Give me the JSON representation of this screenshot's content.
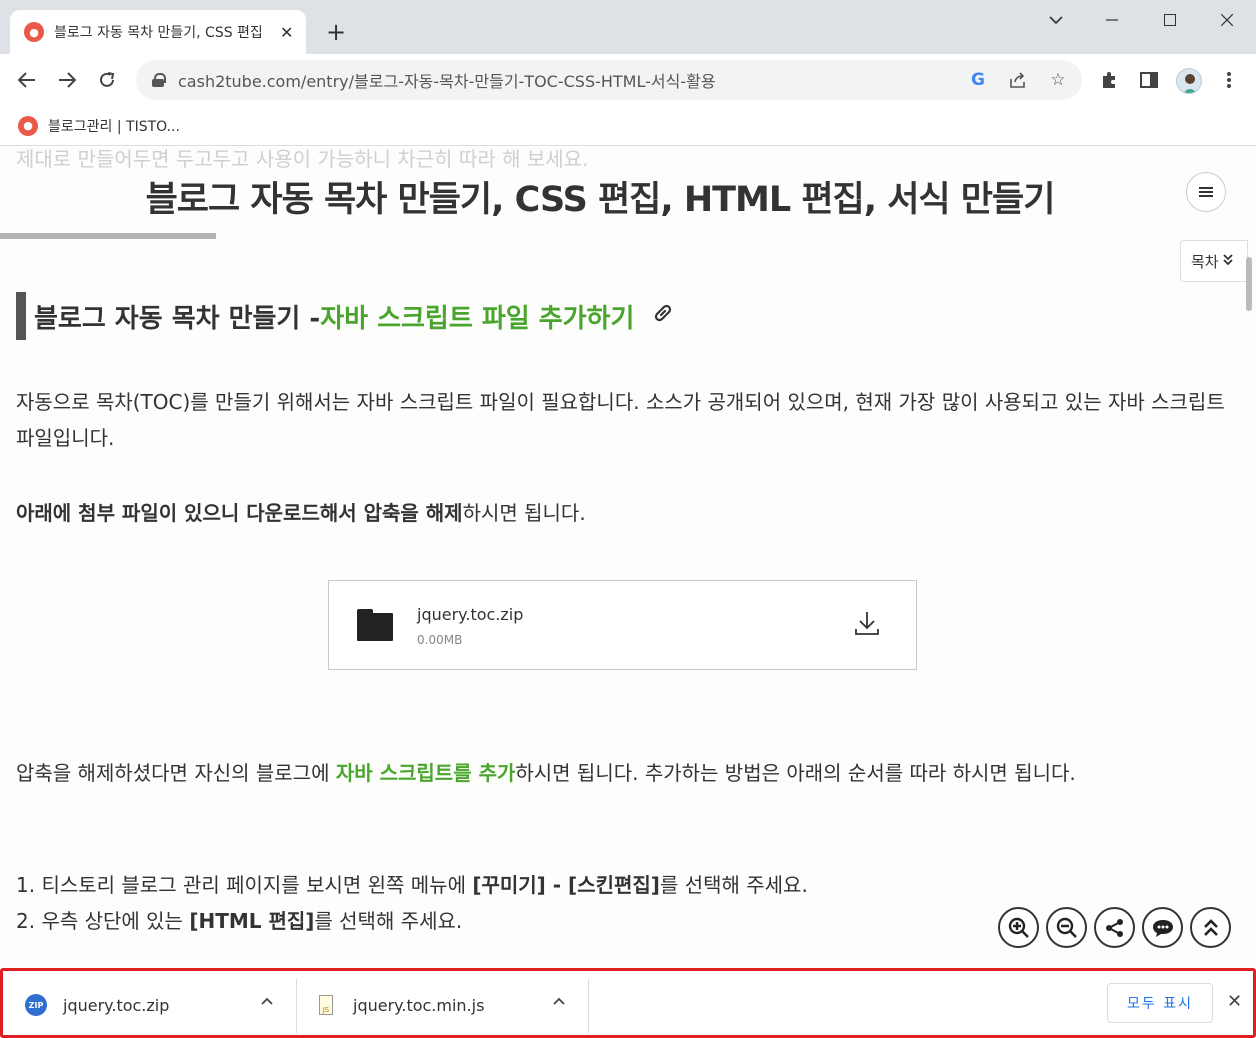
{
  "browser": {
    "tab_title": "블로그 자동 목차 만들기, CSS 편집",
    "tab_favicon": "tistory-favicon",
    "tab_close": "✕",
    "new_tab": "+",
    "url": "cash2tube.com/entry/블로그-자동-목차-만들기-TOC-CSS-HTML-서식-활용",
    "bookmark_label": "블로그관리 | TISTO..."
  },
  "page": {
    "ghost_text": "제대로 만들어두면 두고두고 사용이 가능하니 차근히 따라 해 보세요.",
    "sticky_title": "블로그 자동 목차 만들기, CSS 편집, HTML 편집, 서식 만들기",
    "toc_button": "목차",
    "heading_prefix": "블로그 자동 목차 만들기 - ",
    "heading_highlight": "자바 스크립트 파일 추가하기",
    "para1": "자동으로 목차(TOC)를 만들기 위해서는 자바 스크립트 파일이 필요합니다. 소스가 공개되어 있으며, 현재 가장 많이 사용되고 있는 자바 스크립트 파일입니다.",
    "para2_bold": "아래에 첨부 파일이 있으니 다운로드해서 압축을 해제",
    "para2_rest": "하시면 됩니다.",
    "attachment": {
      "name": "jquery.toc.zip",
      "size": "0.00MB"
    },
    "para3_before": "압축을 해제하셨다면 자신의 블로그에 ",
    "para3_highlight": "자바 스크립트를 추가",
    "para3_after": "하시면 됩니다. 추가하는 방법은 아래의 순서를 따라 하시면 됩니다.",
    "step1_a": "1. 티스토리 블로그 관리 페이지를 보시면 왼쪽 메뉴에 ",
    "step1_b": "[꾸미기] - [스킨편집]",
    "step1_c": "를 선택해 주세요.",
    "step2_a": "2. 우측 상단에 있는 ",
    "step2_b": "[HTML 편집]",
    "step2_c": "를 선택해 주세요."
  },
  "downloads": {
    "items": [
      {
        "name": "jquery.toc.zip",
        "icon": "zip-file-icon"
      },
      {
        "name": "jquery.toc.min.js",
        "icon": "js-file-icon"
      }
    ],
    "show_all": "모두 표시",
    "close": "✕"
  },
  "colors": {
    "accent_green": "#4aa52e",
    "download_bar_border": "#e02020",
    "link_blue": "#1a73e8"
  }
}
